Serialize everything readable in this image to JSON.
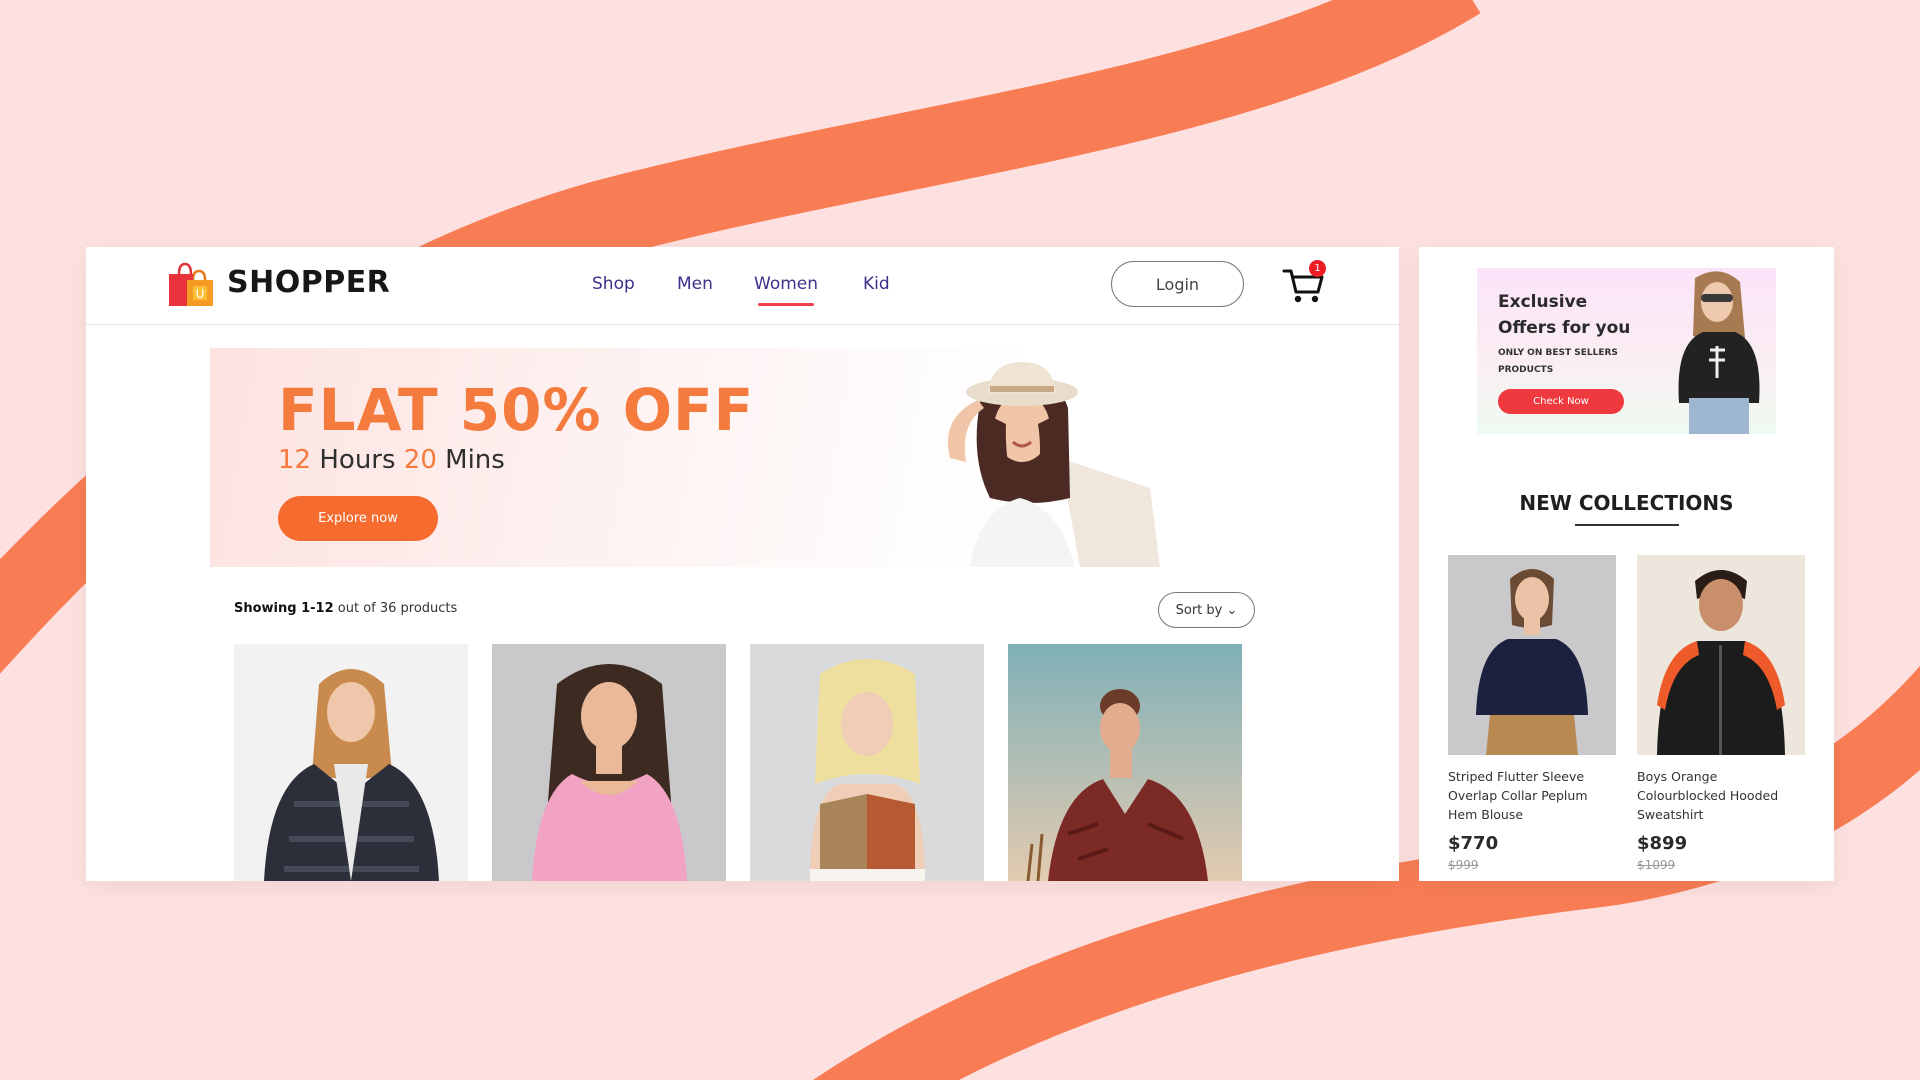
{
  "colors": {
    "background": "#fde0e0",
    "wave": "#f87d55",
    "accent_orange": "#f47a3d",
    "accent_red": "#ee3a3e",
    "nav_text": "#3d2f8a"
  },
  "header": {
    "brand": "SHOPPER",
    "logo_icon": "shopping-bags-icon",
    "nav": [
      {
        "label": "Shop",
        "active": false
      },
      {
        "label": "Men",
        "active": false
      },
      {
        "label": "Women",
        "active": true
      },
      {
        "label": "Kid",
        "active": false
      }
    ],
    "login_label": "Login",
    "cart_icon": "cart-icon",
    "cart_count": "1"
  },
  "hero": {
    "title": "FLAT 50% OFF",
    "hours_value": "12",
    "hours_label": " Hours ",
    "mins_value": "20",
    "mins_label": " Mins",
    "button_label": "Explore now"
  },
  "listing": {
    "showing_range": "Showing 1-12",
    "showing_total": " out of 36 products",
    "sort_label": "Sort by",
    "products": [
      {
        "label": "woman in dark fur jacket"
      },
      {
        "label": "woman in pink top"
      },
      {
        "label": "woman in sports bra"
      },
      {
        "label": "woman in red patterned dress"
      }
    ]
  },
  "offer": {
    "line1": "Exclusive",
    "line2": "Offers for you",
    "subtext": "ONLY ON BEST SELLERS PRODUCTS",
    "button_label": "Check Now"
  },
  "new_collections": {
    "title": "NEW COLLECTIONS",
    "items": [
      {
        "name": "Striped Flutter Sleeve Overlap Collar Peplum Hem Blouse",
        "price": "$770",
        "old_price": "$999"
      },
      {
        "name": "Boys Orange Colourblocked Hooded Sweatshirt",
        "price": "$899",
        "old_price": "$1099"
      }
    ]
  }
}
